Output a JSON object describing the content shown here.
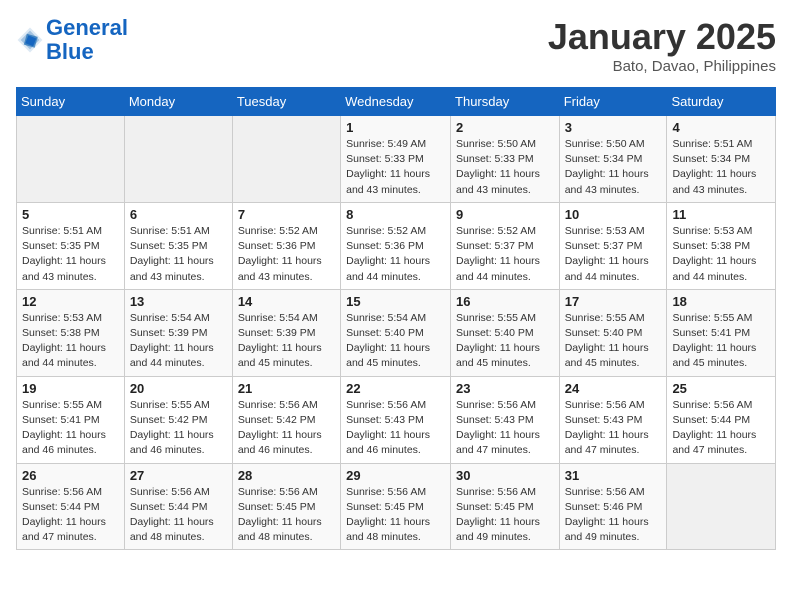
{
  "header": {
    "logo_line1": "General",
    "logo_line2": "Blue",
    "month": "January 2025",
    "location": "Bato, Davao, Philippines"
  },
  "weekdays": [
    "Sunday",
    "Monday",
    "Tuesday",
    "Wednesday",
    "Thursday",
    "Friday",
    "Saturday"
  ],
  "weeks": [
    [
      {
        "day": "",
        "sunrise": "",
        "sunset": "",
        "daylight": ""
      },
      {
        "day": "",
        "sunrise": "",
        "sunset": "",
        "daylight": ""
      },
      {
        "day": "",
        "sunrise": "",
        "sunset": "",
        "daylight": ""
      },
      {
        "day": "1",
        "sunrise": "Sunrise: 5:49 AM",
        "sunset": "Sunset: 5:33 PM",
        "daylight": "Daylight: 11 hours and 43 minutes."
      },
      {
        "day": "2",
        "sunrise": "Sunrise: 5:50 AM",
        "sunset": "Sunset: 5:33 PM",
        "daylight": "Daylight: 11 hours and 43 minutes."
      },
      {
        "day": "3",
        "sunrise": "Sunrise: 5:50 AM",
        "sunset": "Sunset: 5:34 PM",
        "daylight": "Daylight: 11 hours and 43 minutes."
      },
      {
        "day": "4",
        "sunrise": "Sunrise: 5:51 AM",
        "sunset": "Sunset: 5:34 PM",
        "daylight": "Daylight: 11 hours and 43 minutes."
      }
    ],
    [
      {
        "day": "5",
        "sunrise": "Sunrise: 5:51 AM",
        "sunset": "Sunset: 5:35 PM",
        "daylight": "Daylight: 11 hours and 43 minutes."
      },
      {
        "day": "6",
        "sunrise": "Sunrise: 5:51 AM",
        "sunset": "Sunset: 5:35 PM",
        "daylight": "Daylight: 11 hours and 43 minutes."
      },
      {
        "day": "7",
        "sunrise": "Sunrise: 5:52 AM",
        "sunset": "Sunset: 5:36 PM",
        "daylight": "Daylight: 11 hours and 43 minutes."
      },
      {
        "day": "8",
        "sunrise": "Sunrise: 5:52 AM",
        "sunset": "Sunset: 5:36 PM",
        "daylight": "Daylight: 11 hours and 44 minutes."
      },
      {
        "day": "9",
        "sunrise": "Sunrise: 5:52 AM",
        "sunset": "Sunset: 5:37 PM",
        "daylight": "Daylight: 11 hours and 44 minutes."
      },
      {
        "day": "10",
        "sunrise": "Sunrise: 5:53 AM",
        "sunset": "Sunset: 5:37 PM",
        "daylight": "Daylight: 11 hours and 44 minutes."
      },
      {
        "day": "11",
        "sunrise": "Sunrise: 5:53 AM",
        "sunset": "Sunset: 5:38 PM",
        "daylight": "Daylight: 11 hours and 44 minutes."
      }
    ],
    [
      {
        "day": "12",
        "sunrise": "Sunrise: 5:53 AM",
        "sunset": "Sunset: 5:38 PM",
        "daylight": "Daylight: 11 hours and 44 minutes."
      },
      {
        "day": "13",
        "sunrise": "Sunrise: 5:54 AM",
        "sunset": "Sunset: 5:39 PM",
        "daylight": "Daylight: 11 hours and 44 minutes."
      },
      {
        "day": "14",
        "sunrise": "Sunrise: 5:54 AM",
        "sunset": "Sunset: 5:39 PM",
        "daylight": "Daylight: 11 hours and 45 minutes."
      },
      {
        "day": "15",
        "sunrise": "Sunrise: 5:54 AM",
        "sunset": "Sunset: 5:40 PM",
        "daylight": "Daylight: 11 hours and 45 minutes."
      },
      {
        "day": "16",
        "sunrise": "Sunrise: 5:55 AM",
        "sunset": "Sunset: 5:40 PM",
        "daylight": "Daylight: 11 hours and 45 minutes."
      },
      {
        "day": "17",
        "sunrise": "Sunrise: 5:55 AM",
        "sunset": "Sunset: 5:40 PM",
        "daylight": "Daylight: 11 hours and 45 minutes."
      },
      {
        "day": "18",
        "sunrise": "Sunrise: 5:55 AM",
        "sunset": "Sunset: 5:41 PM",
        "daylight": "Daylight: 11 hours and 45 minutes."
      }
    ],
    [
      {
        "day": "19",
        "sunrise": "Sunrise: 5:55 AM",
        "sunset": "Sunset: 5:41 PM",
        "daylight": "Daylight: 11 hours and 46 minutes."
      },
      {
        "day": "20",
        "sunrise": "Sunrise: 5:55 AM",
        "sunset": "Sunset: 5:42 PM",
        "daylight": "Daylight: 11 hours and 46 minutes."
      },
      {
        "day": "21",
        "sunrise": "Sunrise: 5:56 AM",
        "sunset": "Sunset: 5:42 PM",
        "daylight": "Daylight: 11 hours and 46 minutes."
      },
      {
        "day": "22",
        "sunrise": "Sunrise: 5:56 AM",
        "sunset": "Sunset: 5:43 PM",
        "daylight": "Daylight: 11 hours and 46 minutes."
      },
      {
        "day": "23",
        "sunrise": "Sunrise: 5:56 AM",
        "sunset": "Sunset: 5:43 PM",
        "daylight": "Daylight: 11 hours and 47 minutes."
      },
      {
        "day": "24",
        "sunrise": "Sunrise: 5:56 AM",
        "sunset": "Sunset: 5:43 PM",
        "daylight": "Daylight: 11 hours and 47 minutes."
      },
      {
        "day": "25",
        "sunrise": "Sunrise: 5:56 AM",
        "sunset": "Sunset: 5:44 PM",
        "daylight": "Daylight: 11 hours and 47 minutes."
      }
    ],
    [
      {
        "day": "26",
        "sunrise": "Sunrise: 5:56 AM",
        "sunset": "Sunset: 5:44 PM",
        "daylight": "Daylight: 11 hours and 47 minutes."
      },
      {
        "day": "27",
        "sunrise": "Sunrise: 5:56 AM",
        "sunset": "Sunset: 5:44 PM",
        "daylight": "Daylight: 11 hours and 48 minutes."
      },
      {
        "day": "28",
        "sunrise": "Sunrise: 5:56 AM",
        "sunset": "Sunset: 5:45 PM",
        "daylight": "Daylight: 11 hours and 48 minutes."
      },
      {
        "day": "29",
        "sunrise": "Sunrise: 5:56 AM",
        "sunset": "Sunset: 5:45 PM",
        "daylight": "Daylight: 11 hours and 48 minutes."
      },
      {
        "day": "30",
        "sunrise": "Sunrise: 5:56 AM",
        "sunset": "Sunset: 5:45 PM",
        "daylight": "Daylight: 11 hours and 49 minutes."
      },
      {
        "day": "31",
        "sunrise": "Sunrise: 5:56 AM",
        "sunset": "Sunset: 5:46 PM",
        "daylight": "Daylight: 11 hours and 49 minutes."
      },
      {
        "day": "",
        "sunrise": "",
        "sunset": "",
        "daylight": ""
      }
    ]
  ]
}
